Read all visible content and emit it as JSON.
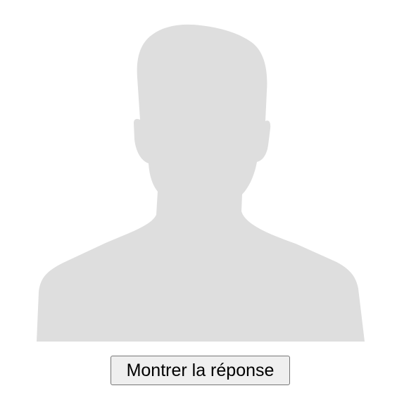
{
  "avatar": {
    "icon": "person-silhouette-icon",
    "fill_color": "#dedede"
  },
  "actions": {
    "reveal_label": "Montrer la réponse"
  }
}
